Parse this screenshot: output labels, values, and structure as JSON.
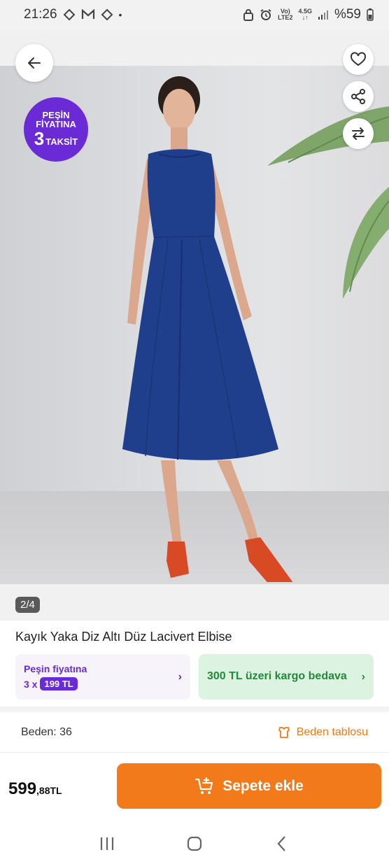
{
  "status_bar": {
    "time": "21:26",
    "dot": "•",
    "network_top": "Vo)",
    "network_bottom": "LTE2",
    "gen_top": "4.5G",
    "gen_bottom": "↓↑",
    "battery": "%59"
  },
  "hero": {
    "promo_line1": "PEŞİN",
    "promo_line2": "FİYATINA",
    "promo_number": "3",
    "promo_line3": "TAKSİT",
    "page_indicator": "2/4"
  },
  "product": {
    "title": "Kayık Yaka Diz Altı Düz Lacivert Elbise",
    "installment_label": "Peşin fiyatına",
    "installment_prefix": "3 x",
    "installment_amount": "199 TL",
    "cargo_text": "300 TL üzeri kargo bedava",
    "chevron": "›"
  },
  "size": {
    "selected": "Beden: 36",
    "size_chart_label": "Beden tablosu"
  },
  "purchase": {
    "price_main": "599",
    "price_decimal": ",88TL",
    "add_to_cart_label": "Sepete ekle"
  },
  "colors": {
    "accent_orange": "#f27a1a",
    "purple": "#6a2bd6",
    "green_text": "#218a3a",
    "dress_blue": "#1f3f8c"
  }
}
